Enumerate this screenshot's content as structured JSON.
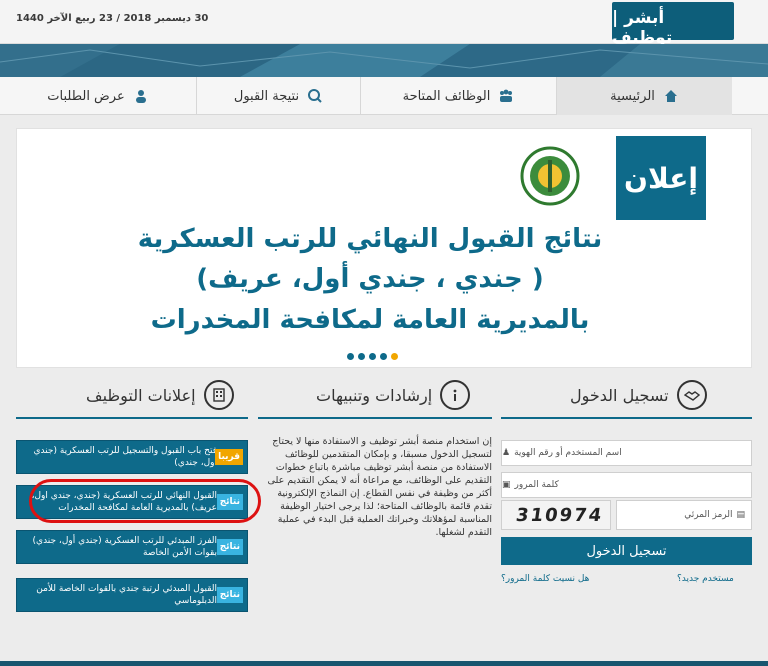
{
  "header": {
    "date": "30 ديسمبر 2018 / 23 ربيع الآخر 1440",
    "logo_text": "أبشر | توظيف"
  },
  "nav": {
    "items": [
      {
        "label": "الرئيسية",
        "icon": "home-icon"
      },
      {
        "label": "الوظائف المتاحة",
        "icon": "people-icon"
      },
      {
        "label": "نتيجة القبول",
        "icon": "result-icon"
      },
      {
        "label": "عرض الطلبات",
        "icon": "user-icon"
      }
    ]
  },
  "banner": {
    "badge": "إعلان",
    "line1": "نتائج القبول النهائي للرتب العسكرية",
    "line2": "( جندي ، جندي أول، عريف)",
    "line3": "بالمديرية العامة لمكافحة المخدرات",
    "slides": 5,
    "active_slide": 5
  },
  "login": {
    "title": "تسجيل الدخول",
    "username_placeholder": "اسم المستخدم أو رقم الهوية",
    "password_placeholder": "كلمة المرور",
    "captcha_placeholder": "الرمز المرئي",
    "captcha_value": "310974",
    "submit_label": "تسجيل الدخول",
    "new_user": "مستخدم جديد؟",
    "forgot_password": "هل نسيت كلمة المرور؟"
  },
  "guidance": {
    "title": "إرشادات وتنبيهات",
    "text": "إن استخدام منصة أبشر توظيف و الاستفادة منها لا يحتاج لتسجيل الدخول مسبقا، و بإمكان المتقدمين للوظائف الاستفادة من منصة أبشر توظيف مباشرة باتباع خطوات التقديم على الوظائف، مع مراعاة أنه لا يمكن التقديم على أكثر من وظيفة في نفس القطاع. إن النماذج الإلكترونية تقدم قائمة بالوظائف المتاحة؛ لذا يرجى اختيار الوظيفة المناسبة لمؤهلاتك وخبراتك العملية قبل البدء في عملية التقدم لشغلها."
  },
  "ads": {
    "title": "إعلانات التوظيف",
    "items": [
      {
        "tag": "قريبا",
        "text": "فتح باب القبول والتسجيل للرتب العسكرية (جندي اول، جندي)"
      },
      {
        "tag": "نتائج",
        "text": "القبول النهائي للرتب العسكرية (جندي، جندي اول، عريف) بالمديرية العامة لمكافحة المخدرات"
      },
      {
        "tag": "نتائج",
        "text": "الفرز المبدئي للرتب العسكرية (جندي أول، جندي) بقوات الأمن الخاصة"
      },
      {
        "tag": "نتائج",
        "text": "القبول المبدئي لرتبة جندي بالقوات الخاصة للأمن الدبلوماسي"
      }
    ]
  },
  "colors": {
    "primary": "#0e6a8a",
    "accent": "#f1a600",
    "tag": "#39b4e1",
    "highlight": "#dd1111"
  }
}
